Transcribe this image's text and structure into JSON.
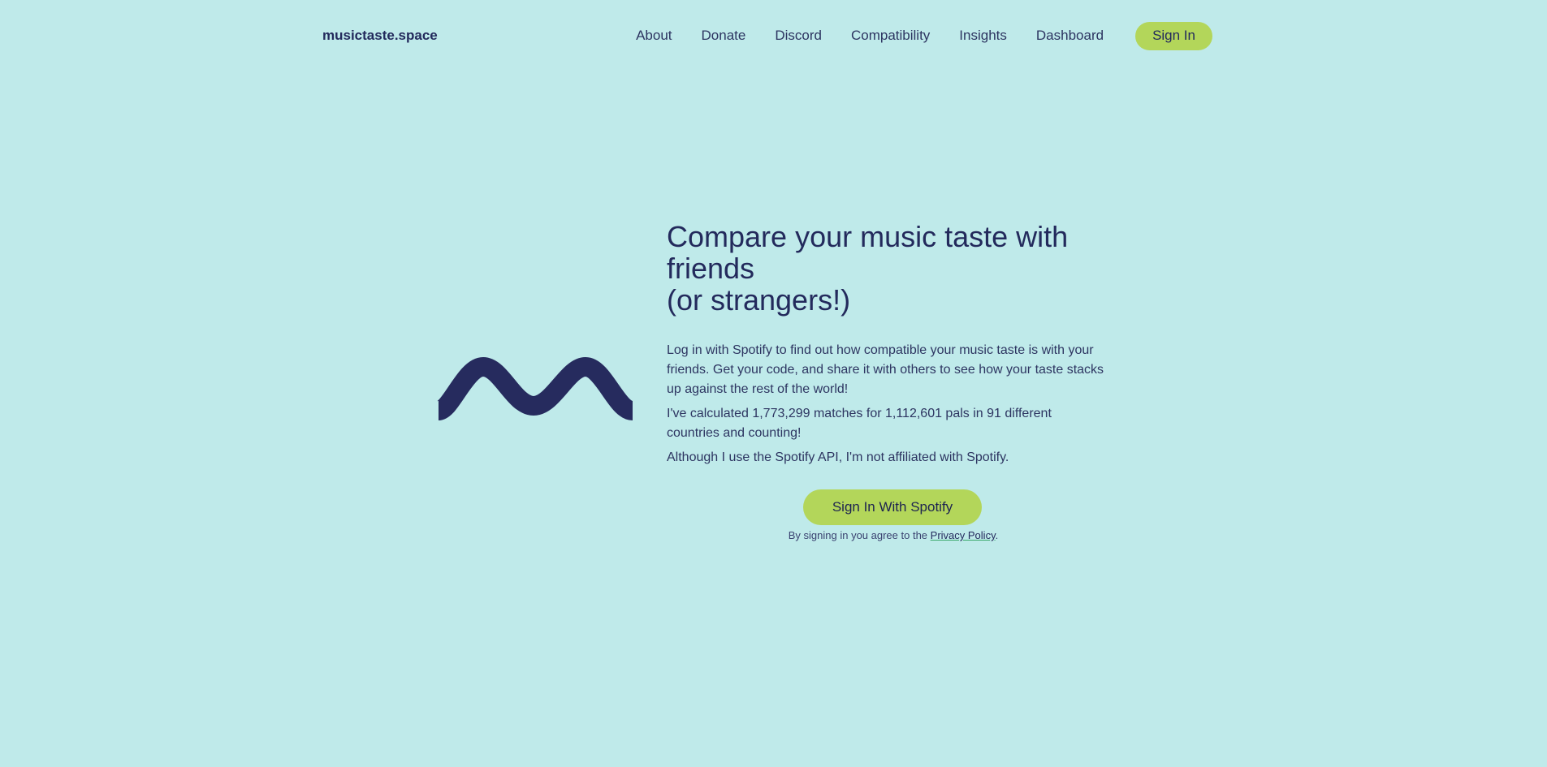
{
  "nav": {
    "brand": "musictaste.space",
    "links": [
      "About",
      "Donate",
      "Discord",
      "Compatibility",
      "Insights",
      "Dashboard"
    ],
    "signin_label": "Sign In"
  },
  "hero": {
    "title_line1": "Compare your music taste with friends",
    "title_line2": "(or strangers!)",
    "paragraphs": [
      "Log in with Spotify to find out how compatible your music taste is with your friends. Get your code, and share it with others to see how your taste stacks up against the rest of the world!",
      "I've calculated 1,773,299 matches for 1,112,601 pals in 91 different countries and counting!",
      "Although I use the Spotify API, I'm not affiliated with Spotify."
    ],
    "cta_label": "Sign In With Spotify",
    "consent_prefix": "By signing in you agree to the",
    "privacy_label": "Privacy Policy",
    "consent_suffix": "."
  },
  "icons": {
    "wave": "wave-logo-icon"
  },
  "colors": {
    "background": "#bfeaea",
    "text": "#232a5c",
    "accent": "#b3d65a",
    "wave": "#262b5e"
  }
}
